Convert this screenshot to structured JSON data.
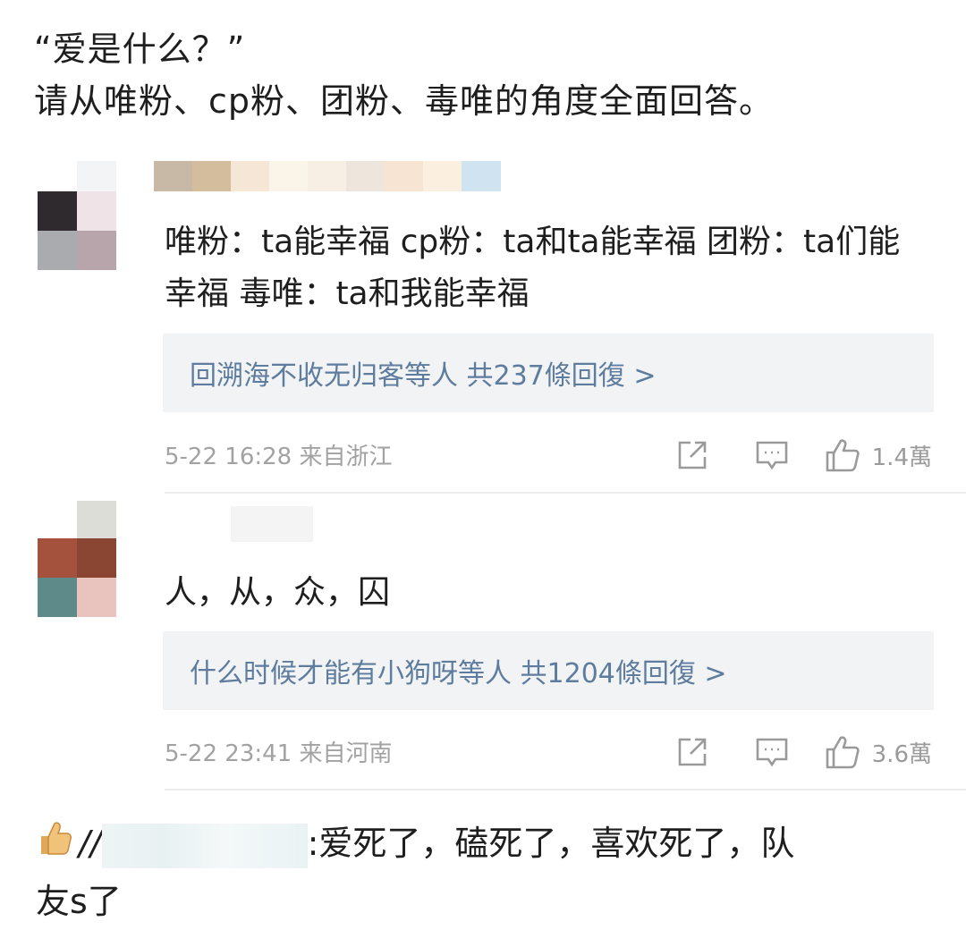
{
  "post": {
    "line1": "“爱是什么？”",
    "line2": "请从唯粉、cp粉、团粉、毒唯的角度全面回答。"
  },
  "comments": [
    {
      "text": "唯粉：ta能幸福 cp粉：ta和ta能幸福 团粉：ta们能幸福 毒唯：ta和我能幸福",
      "reply_summary": "回溯海不收无归客等人 共237條回復 >",
      "time": "5-22 16:28",
      "location": "来自浙江",
      "likes": "1.4萬"
    },
    {
      "text": "人，从，众，囚",
      "reply_summary": "什么时候才能有小狗呀等人 共1204條回復 >",
      "time": "5-22 23:41",
      "location": "来自河南",
      "likes": "3.6萬"
    }
  ],
  "quote": {
    "prefix": "//",
    "text_line1": ":爱死了，磕死了，喜欢死了，队",
    "text_line2": "友s了",
    "icon": "thumbs-up-emoji"
  },
  "colors": {
    "reply_link": "#5d7c9e",
    "meta_gray": "#a2a2a2",
    "reply_bg": "#f2f3f5"
  }
}
